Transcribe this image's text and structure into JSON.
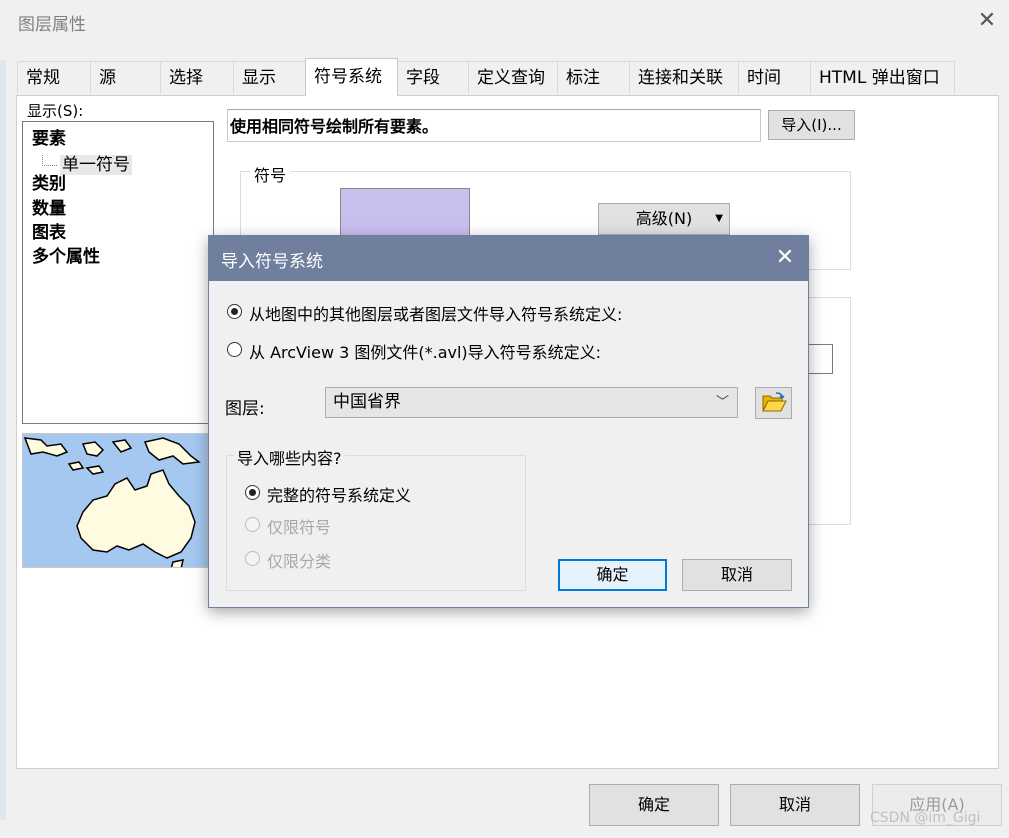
{
  "window": {
    "title": "图层属性",
    "tabs": [
      "常规",
      "源",
      "选择",
      "显示",
      "符号系统",
      "字段",
      "定义查询",
      "标注",
      "连接和关联",
      "时间",
      "HTML 弹出窗口"
    ],
    "active_tab": "符号系统"
  },
  "left_panel": {
    "show_label": "显示(S):",
    "tree": {
      "features": "要素",
      "single_symbol": "单一符号",
      "categories": "类别",
      "quantities": "数量",
      "charts": "图表",
      "multiple_attributes": "多个属性"
    }
  },
  "right_panel": {
    "description": "使用相同符号绘制所有要素。",
    "import_button": "导入(I)...",
    "symbol_group_label": "符号",
    "advanced_button": "高级(N)",
    "symbol_color": "#c7bfee"
  },
  "bottom_buttons": {
    "ok": "确定",
    "cancel": "取消",
    "apply": "应用(A)"
  },
  "watermark": "CSDN @im_Gigi",
  "dialog": {
    "title": "导入符号系统",
    "option_from_map": "从地图中的其他图层或者图层文件导入符号系统定义:",
    "option_from_arcview": "从 ArcView 3 图例文件(*.avl)导入符号系统定义:",
    "layer_label": "图层:",
    "layer_value": "中国省界",
    "content_group_label": "导入哪些内容?",
    "content_options": [
      "完整的符号系统定义",
      "仅限符号",
      "仅限分类"
    ],
    "ok_button": "确定",
    "cancel_button": "取消"
  },
  "colors": {
    "dialog_titlebar": "#6f7f9d",
    "map_water": "#a5c8f0",
    "map_land": "#fefbe0"
  },
  "icons": {
    "window_close": "close-icon",
    "dialog_close": "close-icon",
    "folder": "folder-open-icon",
    "dropdown": "chevron-down-icon"
  }
}
